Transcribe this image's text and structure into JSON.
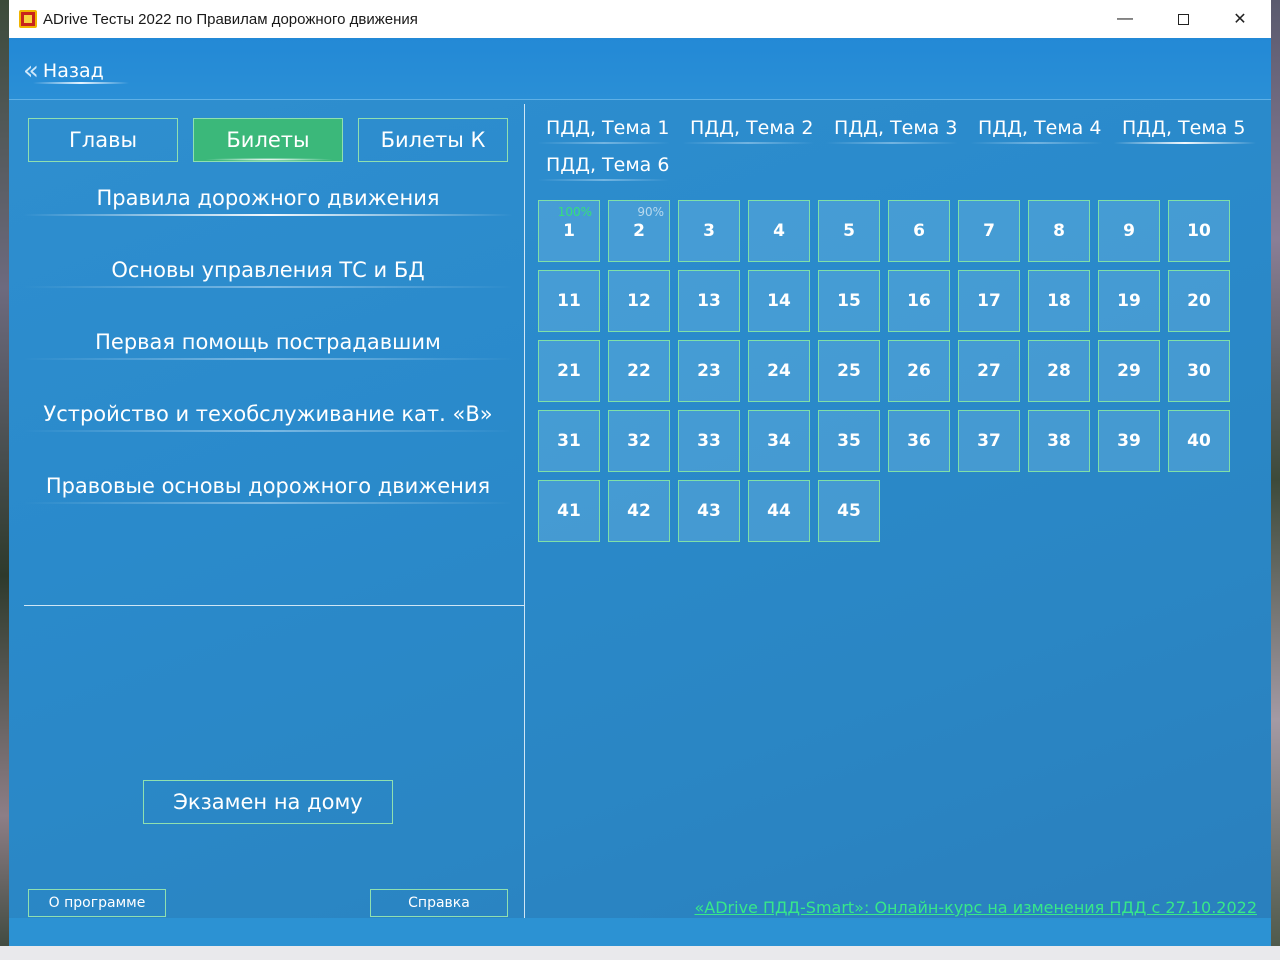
{
  "window": {
    "title": "ADrive Тесты 2022 по Правилам дорожного движения",
    "minimize_glyph": "—",
    "close_glyph": "✕"
  },
  "nav": {
    "back_label": "Назад",
    "back_icon": "double-chevron-left-icon"
  },
  "tabs": [
    {
      "label": "Главы",
      "active": false
    },
    {
      "label": "Билеты",
      "active": true
    },
    {
      "label": "Билеты К",
      "active": false
    }
  ],
  "categories": [
    {
      "label": "Правила дорожного движения",
      "active": true
    },
    {
      "label": "Основы управления ТС и БД",
      "active": false
    },
    {
      "label": "Первая помощь пострадавшим",
      "active": false
    },
    {
      "label": "Устройство и техобслуживание кат. «В»",
      "active": false
    },
    {
      "label": "Правовые основы дорожного движения",
      "active": false
    }
  ],
  "exam_button_label": "Экзамен на дому",
  "about_button_label": "О программе",
  "help_button_label": "Справка",
  "topics": [
    {
      "label": "ПДД, Тема 1",
      "active": false
    },
    {
      "label": "ПДД, Тема 2",
      "active": false
    },
    {
      "label": "ПДД, Тема 3",
      "active": false
    },
    {
      "label": "ПДД, Тема 4",
      "active": false
    },
    {
      "label": "ПДД, Тема 5",
      "active": true
    },
    {
      "label": "ПДД, Тема 6",
      "active": false
    }
  ],
  "tickets": [
    {
      "n": "1",
      "progress": "100%",
      "full": true
    },
    {
      "n": "2",
      "progress": "90%",
      "full": false
    },
    {
      "n": "3"
    },
    {
      "n": "4"
    },
    {
      "n": "5"
    },
    {
      "n": "6"
    },
    {
      "n": "7"
    },
    {
      "n": "8"
    },
    {
      "n": "9"
    },
    {
      "n": "10"
    },
    {
      "n": "11"
    },
    {
      "n": "12"
    },
    {
      "n": "13"
    },
    {
      "n": "14"
    },
    {
      "n": "15"
    },
    {
      "n": "16"
    },
    {
      "n": "17"
    },
    {
      "n": "18"
    },
    {
      "n": "19"
    },
    {
      "n": "20"
    },
    {
      "n": "21"
    },
    {
      "n": "22"
    },
    {
      "n": "23"
    },
    {
      "n": "24"
    },
    {
      "n": "25"
    },
    {
      "n": "26"
    },
    {
      "n": "27"
    },
    {
      "n": "28"
    },
    {
      "n": "29"
    },
    {
      "n": "30"
    },
    {
      "n": "31"
    },
    {
      "n": "32"
    },
    {
      "n": "33"
    },
    {
      "n": "34"
    },
    {
      "n": "35"
    },
    {
      "n": "36"
    },
    {
      "n": "37"
    },
    {
      "n": "38"
    },
    {
      "n": "39"
    },
    {
      "n": "40"
    },
    {
      "n": "41"
    },
    {
      "n": "42"
    },
    {
      "n": "43"
    },
    {
      "n": "44"
    },
    {
      "n": "45"
    }
  ],
  "promo_link": "«ADrive ПДД-Smart»: Онлайн-курс на изменения ПДД с 27.10.2022",
  "colors": {
    "background": "#2a8acb",
    "accent_green": "#3bb87a",
    "border_green": "#8fe0b0",
    "link_green": "#37e889"
  }
}
